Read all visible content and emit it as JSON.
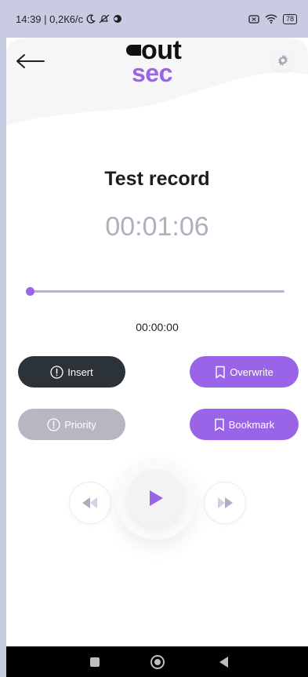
{
  "status_bar": {
    "time_and_speed": "14:39 | 0,2К6/с",
    "battery": "78"
  },
  "header": {
    "logo_top": "out",
    "logo_bottom": "sec"
  },
  "recording": {
    "title": "Test record",
    "duration": "00:01:06",
    "position": "00:00:00",
    "progress_fraction": 0.0
  },
  "actions": {
    "insert": "Insert",
    "overwrite": "Overwrite",
    "priority": "Priority",
    "bookmark": "Bookmark"
  },
  "icons": {
    "back": "arrow-left-icon",
    "settings": "gear-icon",
    "insert": "exclamation-circle-icon",
    "priority": "exclamation-circle-icon",
    "overwrite": "bookmark-icon",
    "bookmark": "bookmark-icon",
    "rewind": "rewind-icon",
    "play": "play-icon",
    "forward": "fast-forward-icon"
  },
  "colors": {
    "accent": "#9a64e8",
    "dark_button": "#2b3238",
    "disabled_button": "#b7b7c1",
    "duration_text": "#b2aebe",
    "status_bar_bg": "#c9cbe3"
  }
}
